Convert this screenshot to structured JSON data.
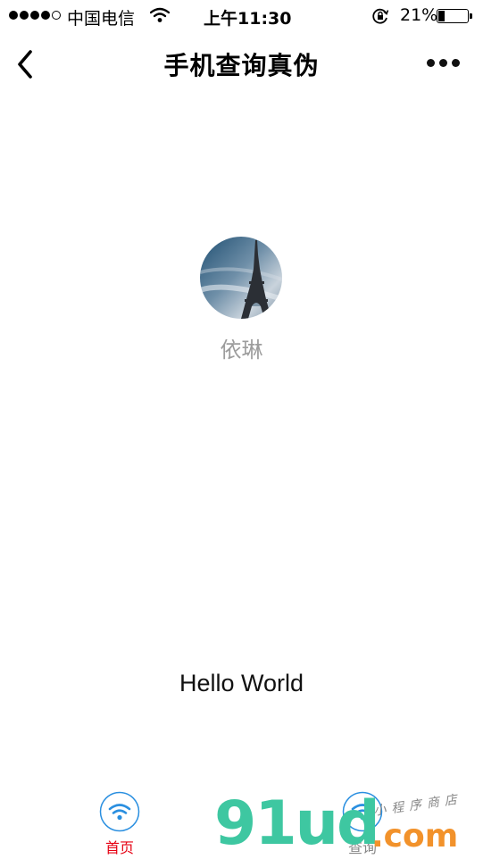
{
  "status_bar": {
    "carrier": "中国电信",
    "time": "上午11:30",
    "battery_percent": "21%",
    "battery_level": 0.21,
    "signal_bars": 4
  },
  "nav": {
    "title": "手机查询真伪",
    "back_icon": "chevron-left-icon",
    "more_icon": "more-dots-icon"
  },
  "profile": {
    "name": "依琳",
    "avatar_icon": "eiffel-tower-photo"
  },
  "main": {
    "message": "Hello World"
  },
  "tab_bar": {
    "items": [
      {
        "label": "首页",
        "icon": "wifi-icon",
        "active": true
      },
      {
        "label": "查询",
        "icon": "wifi-icon",
        "active": false
      }
    ],
    "active_color": "#e60012",
    "inactive_color": "#888888",
    "icon_color": "#2a8fe0"
  },
  "watermark": {
    "brand": "91ud",
    "suffix": ".com",
    "tagline": "小程序商店"
  }
}
